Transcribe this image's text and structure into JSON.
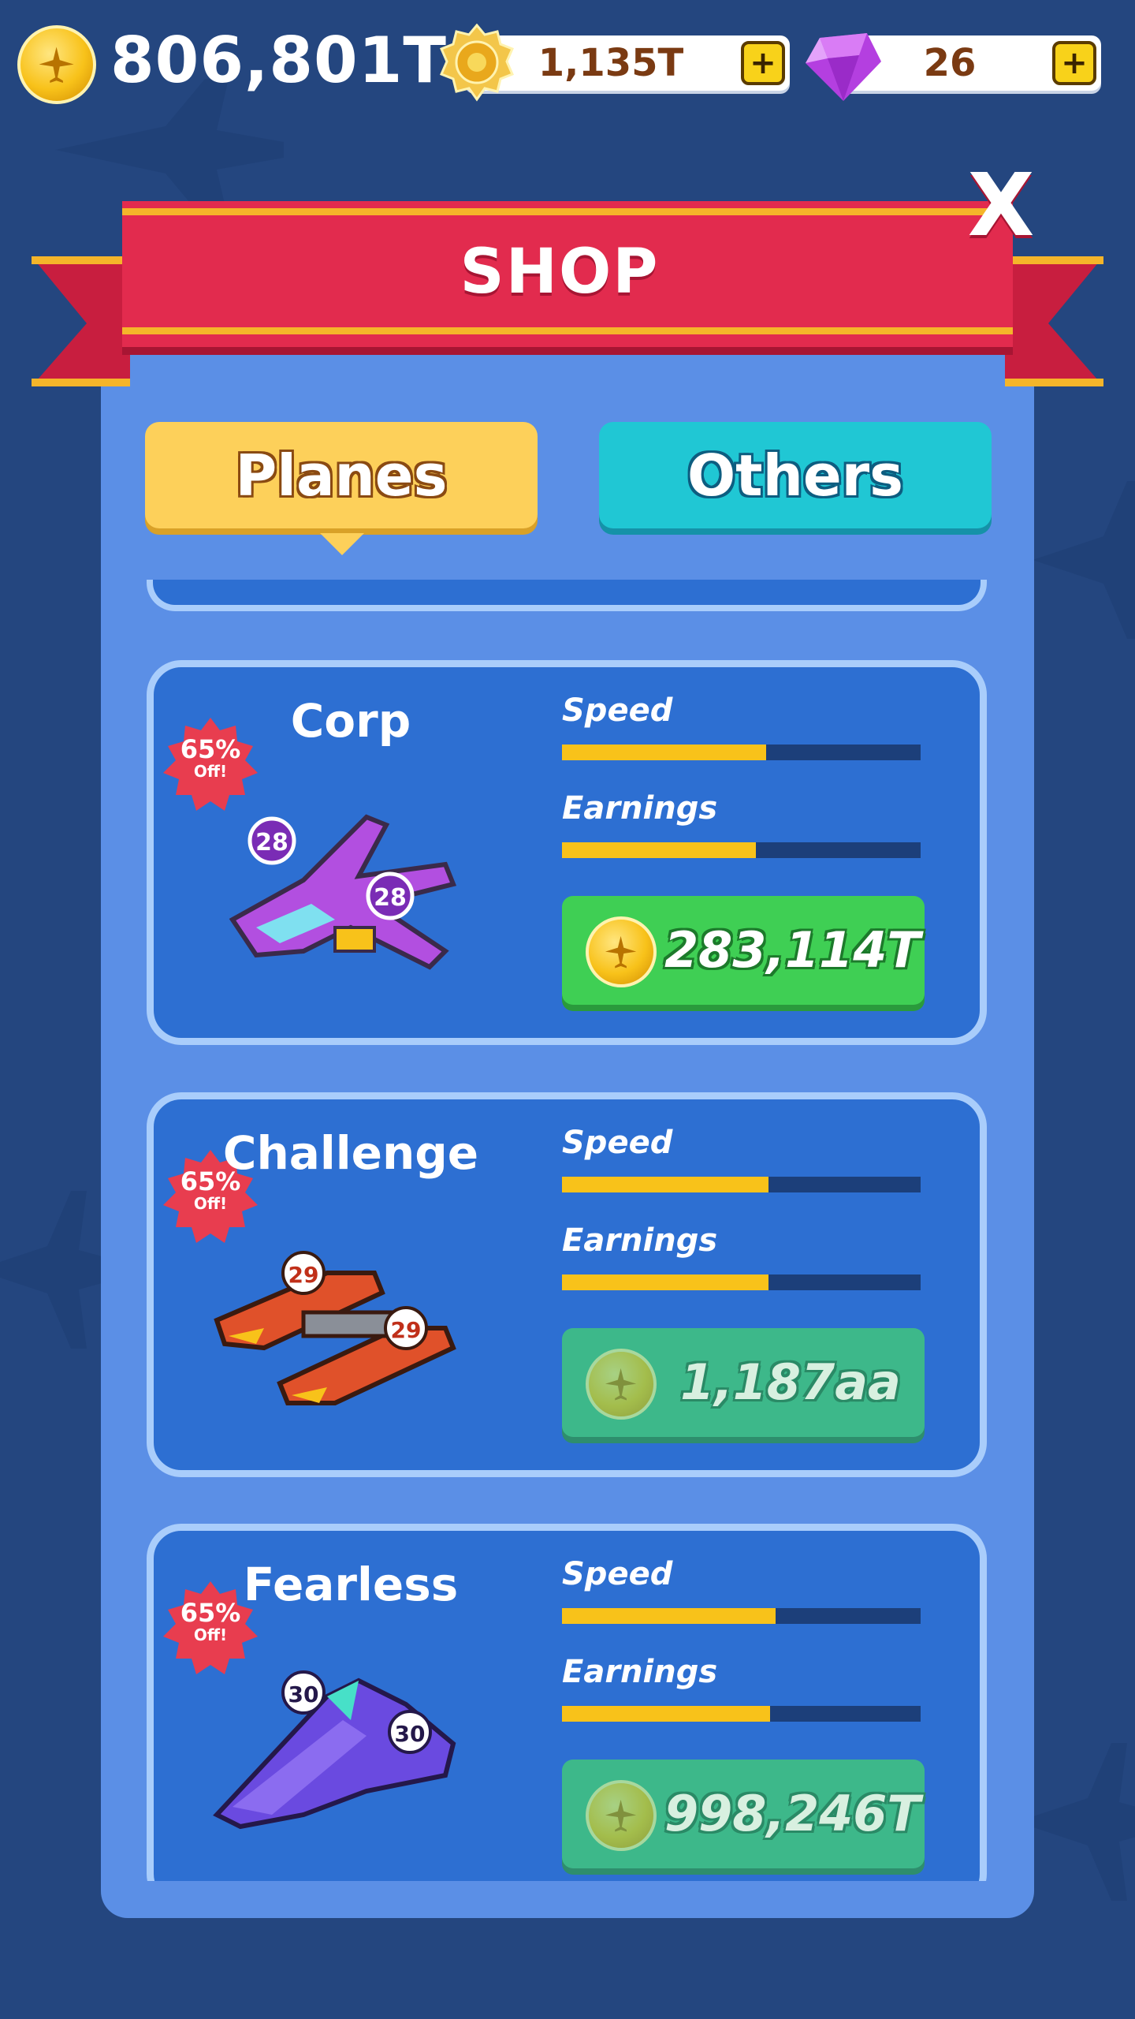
{
  "currency": {
    "gold": "806,801T",
    "medals": "1,135T",
    "gems": "26",
    "plus_label": "+"
  },
  "shop": {
    "title": "SHOP",
    "close_label": "X",
    "tabs": [
      {
        "label": "Planes",
        "selected": true
      },
      {
        "label": "Others",
        "selected": false
      }
    ],
    "items": [
      {
        "name": "Corp",
        "discount_pct": "65%",
        "discount_off": "Off!",
        "speed_label": "Speed",
        "earnings_label": "Earnings",
        "speed_pct": 0.57,
        "earnings_pct": 0.54,
        "price": "283,114T",
        "affordable": true,
        "plane_color": "purple",
        "badge_number": "28"
      },
      {
        "name": "Challenge",
        "discount_pct": "65%",
        "discount_off": "Off!",
        "speed_label": "Speed",
        "earnings_label": "Earnings",
        "speed_pct": 0.575,
        "earnings_pct": 0.575,
        "price": "1,187aa",
        "affordable": false,
        "plane_color": "orange",
        "badge_number": "29"
      },
      {
        "name": "Fearless",
        "discount_pct": "65%",
        "discount_off": "Off!",
        "speed_label": "Speed",
        "earnings_label": "Earnings",
        "speed_pct": 0.595,
        "earnings_pct": 0.58,
        "price": "998,246T",
        "affordable": false,
        "plane_color": "violet",
        "badge_number": "30"
      }
    ]
  },
  "colors": {
    "background": "#24467f",
    "panel": "#5b8fe6",
    "banner": "#e22b4e",
    "bar_fill": "#f8c21a",
    "buy_active": "#3fcf54",
    "buy_locked": "#3db88a"
  }
}
